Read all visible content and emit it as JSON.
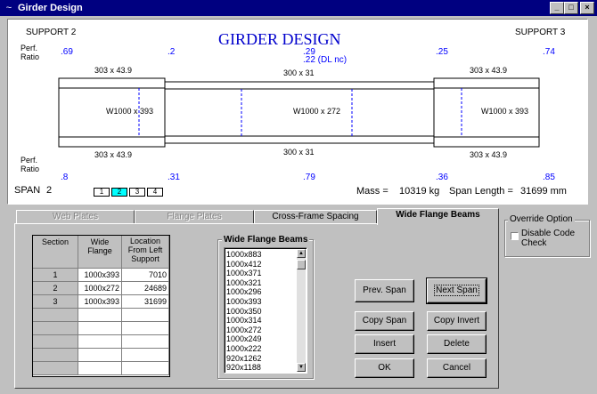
{
  "window": {
    "title": "Girder Design",
    "app_icon": "~"
  },
  "drawing": {
    "title": "GIRDER DESIGN",
    "support_left": "SUPPORT 2",
    "support_right": "SUPPORT 3",
    "perf_label": "Perf.",
    "ratio_label": "Ratio",
    "top_ratios": [
      ".69",
      ".2",
      ".29",
      ".25",
      ".74"
    ],
    "dl_nc_note": ".22 (DL nc)",
    "bottom_ratios": [
      ".8",
      ".31",
      ".79",
      ".36",
      ".85"
    ],
    "top_plates": [
      "303 x 43.9",
      "300 x 31",
      "303 x 43.9"
    ],
    "bottom_plates": [
      "303 x 43.9",
      "300 x 31",
      "303 x 43.9"
    ],
    "web_labels": [
      "W1000 x 393",
      "W1000 x 272",
      "W1000 x 393"
    ],
    "span_label": "SPAN",
    "span_number": "2",
    "span_tabs": [
      "1",
      "2",
      "3",
      "4"
    ],
    "active_span": "2",
    "mass_label": "Mass =",
    "mass_value": "10319 kg",
    "span_length_label": "Span Length =",
    "span_length_value": "31699 mm",
    "colors": {
      "ratio": "#0000ff",
      "title": "#0000cc",
      "span_tab_active": "#00ffff",
      "title_bar": "#000080"
    }
  },
  "tabs": [
    {
      "label": "Web Plates",
      "state": "disabled"
    },
    {
      "label": "Flange Plates",
      "state": "disabled"
    },
    {
      "label": "Cross-Frame Spacing",
      "state": "normal"
    },
    {
      "label": "Wide Flange Beams",
      "state": "active"
    }
  ],
  "grid": {
    "headers": [
      "Section",
      "Wide Flange",
      "Location From Left Support"
    ],
    "rows": [
      [
        "1",
        "1000x393",
        "7010"
      ],
      [
        "2",
        "1000x272",
        "24689"
      ],
      [
        "3",
        "1000x393",
        "31699"
      ],
      [
        "",
        "",
        ""
      ],
      [
        "",
        "",
        ""
      ],
      [
        "",
        "",
        ""
      ],
      [
        "",
        "",
        ""
      ],
      [
        "",
        "",
        ""
      ]
    ]
  },
  "beams_list": {
    "title": "Wide Flange Beams",
    "items": [
      "1000x883",
      "1000x412",
      "1000x371",
      "1000x321",
      "1000x296",
      "1000x393",
      "1000x350",
      "1000x314",
      "1000x272",
      "1000x249",
      "1000x222",
      "920x1262",
      "920x1188"
    ]
  },
  "buttons": {
    "prev_span": "Prev. Span",
    "next_span": "Next Span",
    "copy_span": "Copy Span",
    "copy_invert": "Copy Invert",
    "insert": "Insert",
    "delete": "Delete",
    "ok": "OK",
    "cancel": "Cancel"
  },
  "override": {
    "title": "Override Option",
    "checkbox_label": "Disable Code Check",
    "checked": false
  }
}
